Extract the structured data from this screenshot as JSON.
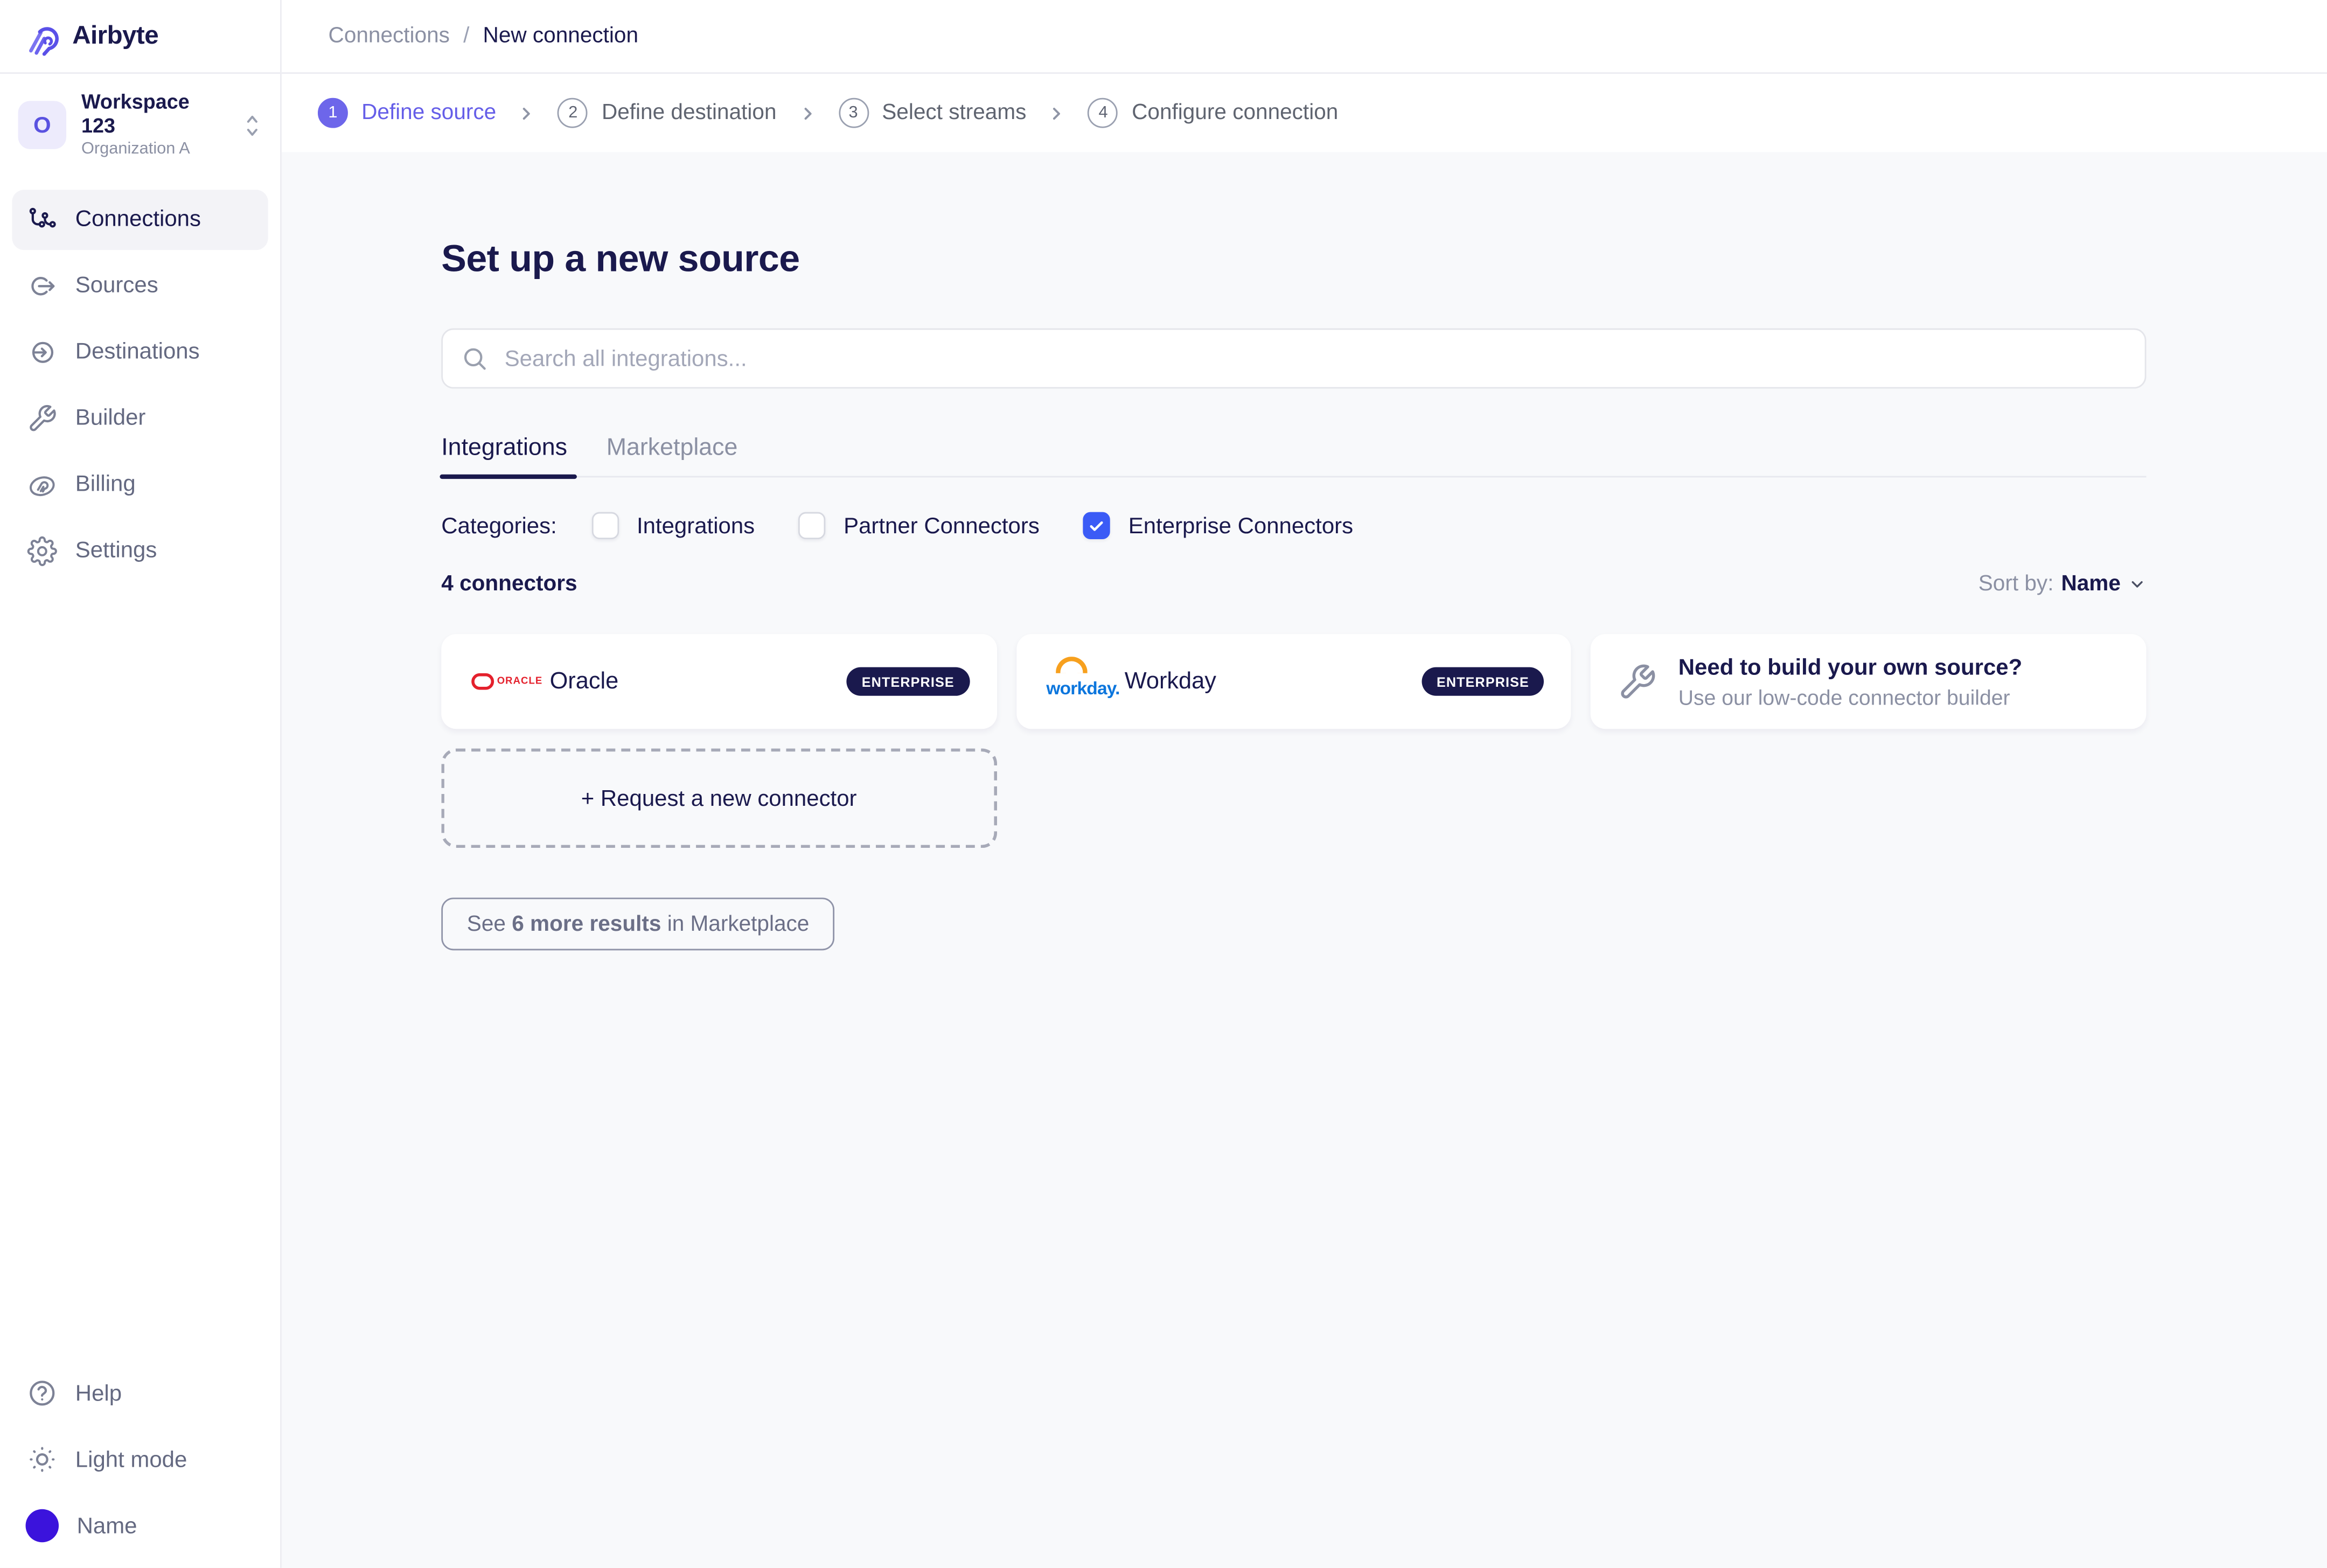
{
  "brand": {
    "name": "Airbyte"
  },
  "workspace": {
    "initial": "O",
    "name": "Workspace 123",
    "org": "Organization A"
  },
  "sidebar": {
    "items": [
      {
        "label": "Connections",
        "active": true
      },
      {
        "label": "Sources",
        "active": false
      },
      {
        "label": "Destinations",
        "active": false
      },
      {
        "label": "Builder",
        "active": false
      },
      {
        "label": "Billing",
        "active": false
      },
      {
        "label": "Settings",
        "active": false
      }
    ],
    "footer": {
      "help": "Help",
      "light_mode": "Light mode",
      "user": "Name"
    }
  },
  "breadcrumb": {
    "parent": "Connections",
    "separator": "/",
    "current": "New connection"
  },
  "stepper": {
    "steps": [
      {
        "num": "1",
        "label": "Define source",
        "active": true
      },
      {
        "num": "2",
        "label": "Define destination",
        "active": false
      },
      {
        "num": "3",
        "label": "Select streams",
        "active": false
      },
      {
        "num": "4",
        "label": "Configure connection",
        "active": false
      }
    ]
  },
  "main": {
    "title": "Set up a new source",
    "search_placeholder": "Search all integrations...",
    "tabs": [
      {
        "label": "Integrations",
        "active": true
      },
      {
        "label": "Marketplace",
        "active": false
      }
    ],
    "categories": {
      "label": "Categories:",
      "options": [
        {
          "label": "Integrations",
          "checked": false
        },
        {
          "label": "Partner Connectors",
          "checked": false
        },
        {
          "label": "Enterprise Connectors",
          "checked": true
        }
      ]
    },
    "results_count": "4 connectors",
    "sort": {
      "label": "Sort by:",
      "value": "Name"
    },
    "connectors": [
      {
        "name": "Oracle",
        "badge": "ENTERPRISE",
        "logo_text": "ORACLE"
      },
      {
        "name": "Workday",
        "badge": "ENTERPRISE",
        "logo_text": "workday."
      }
    ],
    "builder_card": {
      "title": "Need to build your own source?",
      "subtitle": "Use our low-code connector builder"
    },
    "request_button": "+ Request a new connector",
    "see_more": {
      "prefix": "See ",
      "bold": "6 more results",
      "suffix": " in Marketplace"
    }
  },
  "colors": {
    "navy_text": "#1a194d",
    "gray_text": "#8b90a3",
    "accent_indigo": "#6d66ea",
    "checkbox_blue": "#3b5bf6",
    "badge_bg": "#1a194d",
    "oracle_red": "#e4202c",
    "workday_blue": "#0c76dd",
    "workday_orange": "#f7a01e",
    "user_avatar": "#3b13dc",
    "content_bg": "#f8f9fb"
  }
}
